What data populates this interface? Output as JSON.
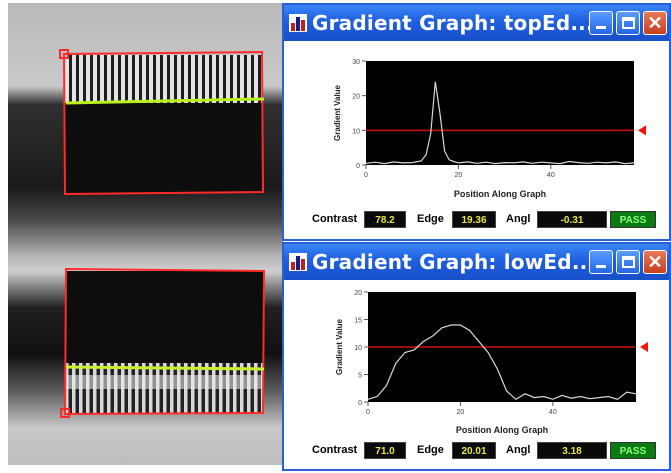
{
  "colors": {
    "titlebar": "#1f5fe0",
    "threshold_line": "#d01010",
    "threshold_marker": "#ff1010",
    "roi_box": "#ff2a2a",
    "edge_line": "#b8f020",
    "readout_text": "#e8e840",
    "pass_bg": "#0b7a12",
    "pass_text": "#8cff7a"
  },
  "top_window": {
    "title": "Gradient Graph: topEd...",
    "title_icon": "bar-chart-icon",
    "controls": {
      "minimize": "minimize-icon",
      "maximize": "maximize-icon",
      "close": "close-icon",
      "close_glyph": "✕"
    },
    "readouts": {
      "contrast_label": "Contrast",
      "contrast_value": "78.2",
      "edge_label": "Edge",
      "edge_value": "19.36",
      "angle_label": "Angl",
      "angle_value": "-0.31",
      "status": "PASS"
    },
    "chart_data": {
      "type": "line",
      "xlabel": "Position Along Graph",
      "ylabel": "Gradient Value",
      "ylim": [
        0,
        30
      ],
      "xlim": [
        0,
        58
      ],
      "yticks": [
        "30",
        "20",
        "10",
        "0"
      ],
      "yticks_values": [
        30,
        20,
        10,
        0
      ],
      "xticks": [
        "0",
        "20",
        "40"
      ],
      "xticks_values": [
        0,
        20,
        40
      ],
      "threshold": 10,
      "x": [
        0,
        2,
        4,
        6,
        8,
        10,
        12,
        13,
        14,
        15,
        16,
        17,
        18,
        19,
        20,
        22,
        24,
        26,
        28,
        30,
        32,
        34,
        36,
        38,
        40,
        42,
        44,
        46,
        48,
        50,
        52,
        54,
        56,
        58
      ],
      "y": [
        0.5,
        0.8,
        0.4,
        0.9,
        0.6,
        0.7,
        1.2,
        3,
        9,
        24,
        15,
        4,
        1.5,
        1,
        0.6,
        0.9,
        0.5,
        0.8,
        0.4,
        0.7,
        0.6,
        0.9,
        0.5,
        0.8,
        0.6,
        0.4,
        1,
        0.7,
        0.5,
        0.8,
        0.6,
        0.9,
        0.4,
        0.6
      ]
    }
  },
  "low_window": {
    "title": "Gradient Graph: lowEd...",
    "title_icon": "bar-chart-icon",
    "controls": {
      "minimize": "minimize-icon",
      "maximize": "maximize-icon",
      "close": "close-icon",
      "close_glyph": "✕"
    },
    "readouts": {
      "contrast_label": "Contrast",
      "contrast_value": "71.0",
      "edge_label": "Edge",
      "edge_value": "20.01",
      "angle_label": "Angl",
      "angle_value": "3.18",
      "status": "PASS"
    },
    "chart_data": {
      "type": "line",
      "xlabel": "Position Along Graph",
      "ylabel": "Gradient Value",
      "ylim": [
        0,
        20
      ],
      "xlim": [
        0,
        58
      ],
      "yticks": [
        "20",
        "15",
        "10",
        "5",
        "0"
      ],
      "yticks_values": [
        20,
        15,
        10,
        5,
        0
      ],
      "xticks": [
        "0",
        "20",
        "40"
      ],
      "xticks_values": [
        0,
        20,
        40
      ],
      "threshold": 10,
      "x": [
        0,
        2,
        4,
        6,
        8,
        10,
        12,
        14,
        16,
        18,
        20,
        22,
        24,
        26,
        28,
        30,
        32,
        34,
        36,
        38,
        40,
        42,
        44,
        46,
        48,
        50,
        52,
        54,
        56,
        58
      ],
      "y": [
        0.5,
        1,
        3,
        7,
        9,
        9.5,
        11,
        12,
        13.5,
        14,
        14,
        13,
        11,
        9,
        6,
        2,
        0.5,
        1.5,
        0.8,
        1,
        0.5,
        1.2,
        0.7,
        1,
        0.6,
        0.8,
        1,
        0.5,
        1.8,
        1.5
      ]
    }
  },
  "camera_view": {
    "overlay_icon": "edge-inspection-overlay"
  }
}
